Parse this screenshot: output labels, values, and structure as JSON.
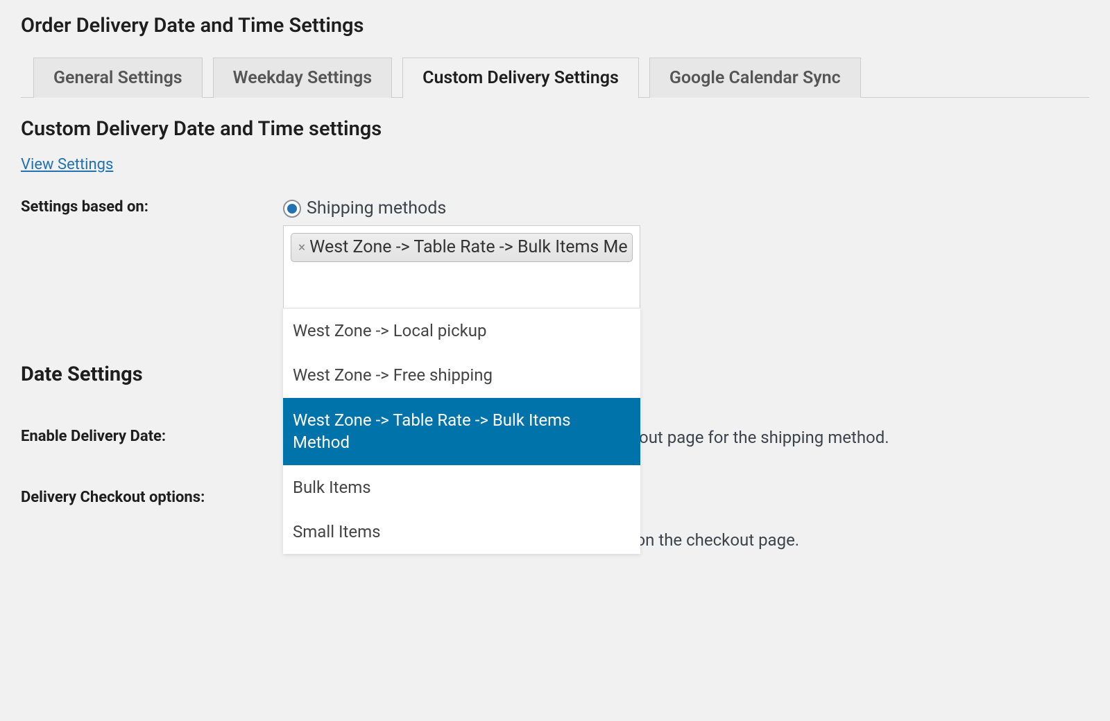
{
  "page_title": "Order Delivery Date and Time Settings",
  "tabs": {
    "general": "General Settings",
    "weekday": "Weekday Settings",
    "custom": "Custom Delivery Settings",
    "google": "Google Calendar Sync"
  },
  "section_title": "Custom Delivery Date and Time settings",
  "view_settings_link": "View Settings",
  "settings_based_on": {
    "label": "Settings based on:",
    "radio_label": "Shipping methods",
    "selected_chip": "West Zone -> Table Rate -> Bulk Items Me",
    "options": {
      "o1": "West Zone -> Local pickup",
      "o2": "West Zone -> Free shipping",
      "o3": "West Zone -> Table Rate -> Bulk Items Method",
      "o4": "Bulk Items",
      "o5": "Small Items"
    }
  },
  "date_settings": {
    "heading": "Date Settings",
    "enable_label": "Enable Delivery Date:",
    "enable_desc_suffix": "out page for the shipping method.",
    "checkout_label": "Delivery Checkout options:",
    "checkout_desc": "Choose the delivery date option to be displayed on the checkout page."
  }
}
